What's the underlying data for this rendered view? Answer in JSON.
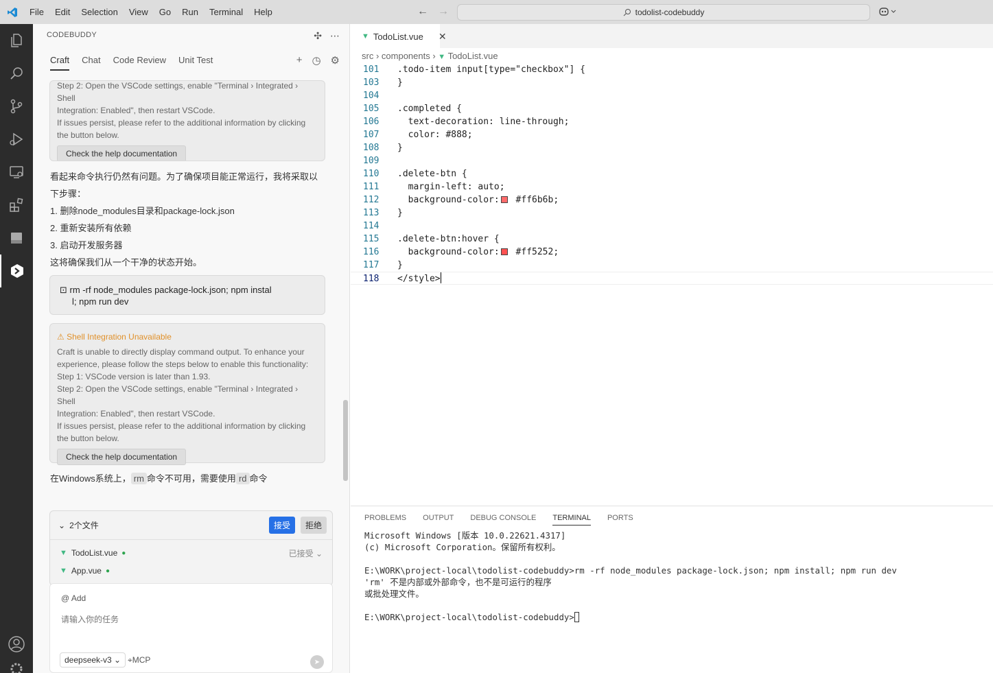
{
  "menu": [
    "File",
    "Edit",
    "Selection",
    "View",
    "Go",
    "Run",
    "Terminal",
    "Help"
  ],
  "search": {
    "text": "todolist-codebuddy"
  },
  "sidebar": {
    "title": "CODEBUDDY",
    "tabs": [
      "Craft",
      "Chat",
      "Code Review",
      "Unit Test"
    ],
    "card1": {
      "lines": [
        "Step 2: Open the VSCode settings, enable \"Terminal › Integrated › Shell",
        "Integration: Enabled\", then restart VSCode.",
        "If issues persist, please refer to the additional information by clicking",
        "the button below."
      ],
      "button": "Check the help documentation"
    },
    "message": {
      "lines": [
        "看起来命令执行仍然有问题。为了确保项目能正常运行，我将采取以",
        "下步骤：",
        "1. 删除node_modules目录和package-lock.json",
        "2. 重新安装所有依赖",
        "3. 启动开发服务器",
        "这将确保我们从一个干净的状态开始。"
      ]
    },
    "command": {
      "line1": "rm -rf node_modules package-lock.json; npm instal",
      "line2": "l; npm run dev"
    },
    "card2": {
      "title": "Shell Integration Unavailable",
      "lines": [
        "Craft is unable to directly display command output. To enhance your",
        "experience, please follow the steps below to enable this functionality:",
        "Step 1: VSCode version is later than 1.93.",
        "Step 2: Open the VSCode settings, enable \"Terminal › Integrated › Shell",
        "Integration: Enabled\", then restart VSCode.",
        "If issues persist, please refer to the additional information by clicking",
        "the button below."
      ],
      "button": "Check the help documentation"
    },
    "note": {
      "pre": "在Windows系统上，",
      "rm": "rm",
      "mid": "命令不可用，需要使用",
      "rd": "rd",
      "post": "命令"
    },
    "files": {
      "header": "2个文件",
      "accept": "接受",
      "reject": "拒绝",
      "status": "已接受",
      "items": [
        "TodoList.vue",
        "App.vue"
      ]
    },
    "input": {
      "add": "@ Add",
      "placeholder": "请输入你的任务",
      "model": "deepseek-v3",
      "mcp": "MCP"
    }
  },
  "editor": {
    "tab": "TodoList.vue",
    "breadcrumb": [
      "src",
      "components",
      "TodoList.vue"
    ],
    "lines": [
      {
        "n": "101",
        "t": ".todo-item input[type=\"checkbox\"] {"
      },
      {
        "n": "103",
        "t": "}"
      },
      {
        "n": "104",
        "t": ""
      },
      {
        "n": "105",
        "t": ".completed {"
      },
      {
        "n": "106",
        "t": "  text-decoration: line-through;"
      },
      {
        "n": "107",
        "t": "  color: #888;"
      },
      {
        "n": "108",
        "t": "}"
      },
      {
        "n": "109",
        "t": ""
      },
      {
        "n": "110",
        "t": ".delete-btn {"
      },
      {
        "n": "111",
        "t": "  margin-left: auto;"
      },
      {
        "n": "112",
        "t": "  background-color:",
        "swatch": "#ff6b6b",
        "rest": " #ff6b6b;"
      },
      {
        "n": "113",
        "t": "}"
      },
      {
        "n": "114",
        "t": ""
      },
      {
        "n": "115",
        "t": ".delete-btn:hover {"
      },
      {
        "n": "116",
        "t": "  background-color:",
        "swatch": "#ff5252",
        "rest": " #ff5252;"
      },
      {
        "n": "117",
        "t": "}"
      },
      {
        "n": "118",
        "t": "</style>"
      }
    ]
  },
  "panel": {
    "tabs": [
      "PROBLEMS",
      "OUTPUT",
      "DEBUG CONSOLE",
      "TERMINAL",
      "PORTS"
    ],
    "terminal": [
      "Microsoft Windows [版本 10.0.22621.4317]",
      "(c) Microsoft Corporation。保留所有权利。",
      "",
      "E:\\WORK\\project-local\\todolist-codebuddy>rm -rf node_modules package-lock.json; npm install; npm run dev",
      "'rm' 不是内部或外部命令，也不是可运行的程序",
      "或批处理文件。",
      "",
      "E:\\WORK\\project-local\\todolist-codebuddy>"
    ]
  }
}
